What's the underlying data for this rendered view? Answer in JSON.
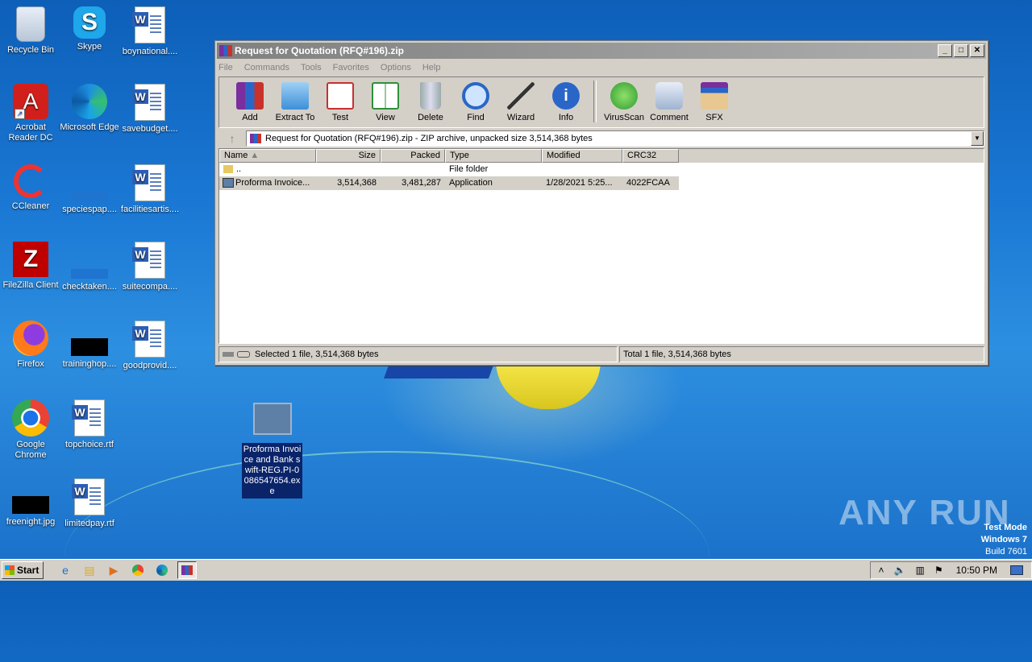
{
  "desktop": {
    "icons": [
      {
        "label": "Recycle Bin"
      },
      {
        "label": "Skype"
      },
      {
        "label": "boynational...."
      },
      {
        "label": "Acrobat Reader DC"
      },
      {
        "label": "Microsoft Edge"
      },
      {
        "label": "savebudget...."
      },
      {
        "label": "CCleaner"
      },
      {
        "label": "speciespap...."
      },
      {
        "label": "facilitiesartis...."
      },
      {
        "label": "FileZilla Client"
      },
      {
        "label": "checktaken...."
      },
      {
        "label": "suitecompa...."
      },
      {
        "label": "Firefox"
      },
      {
        "label": "traininghop...."
      },
      {
        "label": "goodprovid...."
      },
      {
        "label": "Google Chrome"
      },
      {
        "label": "topchoice.rtf"
      },
      {
        "label": "freenight.jpg"
      },
      {
        "label": "limitedpay.rtf"
      }
    ],
    "selected_file": "Proforma Invoice and Bank swift-REG.PI-0086547654.exe"
  },
  "window": {
    "title": "Request for Quotation (RFQ#196).zip",
    "menu": [
      "File",
      "Commands",
      "Tools",
      "Favorites",
      "Options",
      "Help"
    ],
    "toolbar": [
      "Add",
      "Extract To",
      "Test",
      "View",
      "Delete",
      "Find",
      "Wizard",
      "Info",
      "VirusScan",
      "Comment",
      "SFX"
    ],
    "address": "Request for Quotation (RFQ#196).zip - ZIP archive, unpacked size 3,514,368 bytes",
    "columns": [
      "Name",
      "Size",
      "Packed",
      "Type",
      "Modified",
      "CRC32"
    ],
    "rows": [
      {
        "name": "..",
        "size": "",
        "packed": "",
        "type": "File folder",
        "modified": "",
        "crc": ""
      },
      {
        "name": "Proforma Invoice...",
        "size": "3,514,368",
        "packed": "3,481,287",
        "type": "Application",
        "modified": "1/28/2021 5:25...",
        "crc": "4022FCAA"
      }
    ],
    "status_left": "Selected 1 file, 3,514,368 bytes",
    "status_right": "Total 1 file, 3,514,368 bytes"
  },
  "watermark": "ANY RUN",
  "test_mode": {
    "line1": "Test Mode",
    "line2": "Windows 7",
    "line3": "Build 7601"
  },
  "taskbar": {
    "start": "Start",
    "clock": "10:50 PM"
  }
}
